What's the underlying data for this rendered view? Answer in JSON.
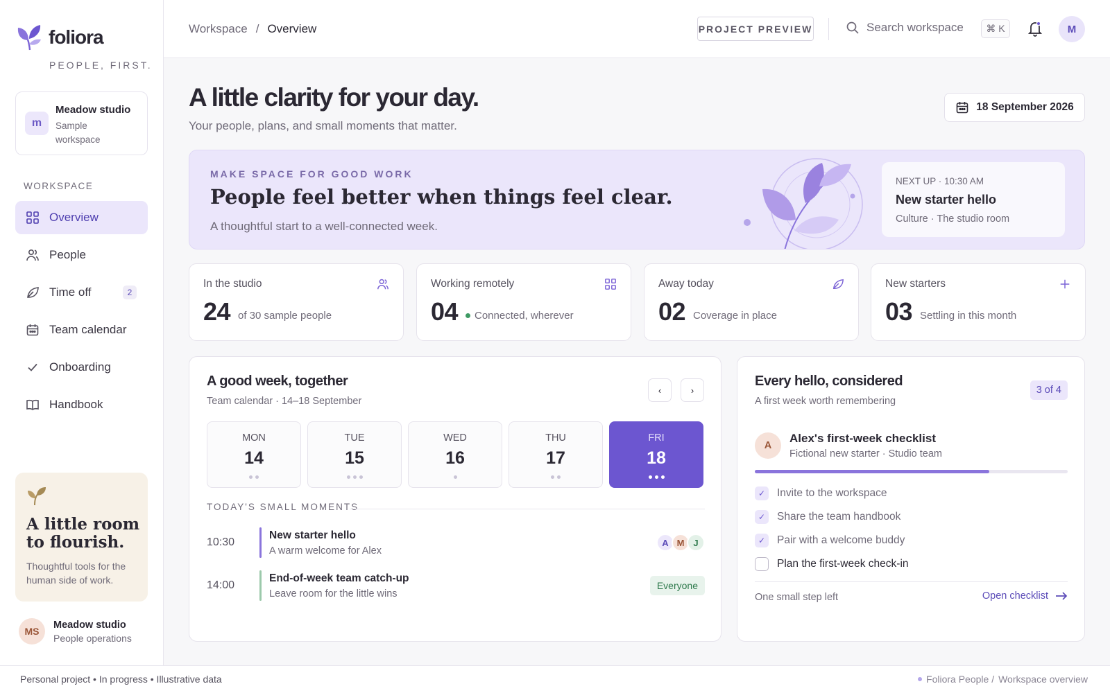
{
  "brand": {
    "name": "foliora",
    "tagline": "PEOPLE, FIRST."
  },
  "workspace_card": {
    "initial": "m",
    "name": "Meadow studio",
    "sub": "Sample workspace"
  },
  "sidebar": {
    "section_label": "WORKSPACE",
    "items": [
      {
        "label": "Overview",
        "icon": "grid-icon",
        "active": true
      },
      {
        "label": "People",
        "icon": "people-icon"
      },
      {
        "label": "Time off",
        "icon": "leaf-icon",
        "badge": "2"
      },
      {
        "label": "Team calendar",
        "icon": "calendar-icon"
      },
      {
        "label": "Onboarding",
        "icon": "check-icon"
      },
      {
        "label": "Handbook",
        "icon": "book-icon"
      }
    ],
    "flourish": {
      "title": "A little room to flourish.",
      "body": "Thoughtful tools for the human side of work."
    },
    "profile": {
      "initials": "MS",
      "name": "Meadow studio",
      "role": "People operations"
    }
  },
  "topbar": {
    "breadcrumb": {
      "parent": "Workspace",
      "separator": "/",
      "current": "Overview"
    },
    "preview_button": "PROJECT PREVIEW",
    "search_placeholder": "Search workspace",
    "shortcut": "⌘ K",
    "user_initial": "M"
  },
  "hero": {
    "title": "A little clarity for your day.",
    "subtitle": "Your people, plans, and small moments that matter.",
    "date": "18 September 2026"
  },
  "banner": {
    "kicker": "MAKE SPACE FOR GOOD WORK",
    "title": "People feel better when things feel clear.",
    "subtitle": "A thoughtful start to a well-connected week.",
    "next_up": {
      "kicker": "NEXT UP · 10:30 AM",
      "title": "New starter hello",
      "sub": "Culture · The studio room"
    }
  },
  "stats": [
    {
      "label": "In the studio",
      "value": "24",
      "note": "of 30 sample people",
      "icon": "people-icon"
    },
    {
      "label": "Working remotely",
      "value": "04",
      "note": "Connected, wherever",
      "icon": "grid-icon"
    },
    {
      "label": "Away today",
      "value": "02",
      "note": "Coverage in place",
      "icon": "leaf-icon"
    },
    {
      "label": "New starters",
      "value": "03",
      "note": "Settling in this month",
      "icon": "plus-icon"
    }
  ],
  "week": {
    "title": "A good week, together",
    "subtitle": "Team calendar · 14–18 September",
    "prev": "‹",
    "next": "›",
    "days": [
      {
        "name": "MON",
        "num": "14",
        "dots": 2
      },
      {
        "name": "TUE",
        "num": "15",
        "dots": 3
      },
      {
        "name": "WED",
        "num": "16",
        "dots": 1
      },
      {
        "name": "THU",
        "num": "17",
        "dots": 2
      },
      {
        "name": "FRI",
        "num": "18",
        "dots": 3,
        "active": true
      }
    ],
    "moments_label": "TODAY'S SMALL MOMENTS",
    "moments": [
      {
        "time": "10:30",
        "title": "New starter hello",
        "sub": "A warm welcome for Alex",
        "avatars": [
          "A",
          "M",
          "J"
        ]
      },
      {
        "time": "14:00",
        "title": "End-of-week team catch-up",
        "sub": "Leave room for the little wins",
        "tag": "Everyone"
      }
    ]
  },
  "hello": {
    "title": "Every hello, considered",
    "subtitle": "A first week worth remembering",
    "count": "3 of 4",
    "person": {
      "initial": "A",
      "name": "Alex's first-week checklist",
      "sub": "Fictional new starter · Studio team"
    },
    "progress": 0.75,
    "items": [
      {
        "label": "Invite to the workspace",
        "done": true
      },
      {
        "label": "Share the team handbook",
        "done": true
      },
      {
        "label": "Pair with a welcome buddy",
        "done": true
      },
      {
        "label": "Plan the first-week check-in",
        "done": false
      }
    ],
    "footer_note": "One small step left",
    "link": "Open checklist"
  },
  "footer": {
    "left": "Personal project • In progress • Illustrative data",
    "right_a": "Foliora People /",
    "right_b": "Workspace overview"
  },
  "colors": {
    "accent": "#6c56d0",
    "accent_soft": "#ebe6fb",
    "positive": "#3e9a63",
    "warm": "#f7f1e7"
  }
}
